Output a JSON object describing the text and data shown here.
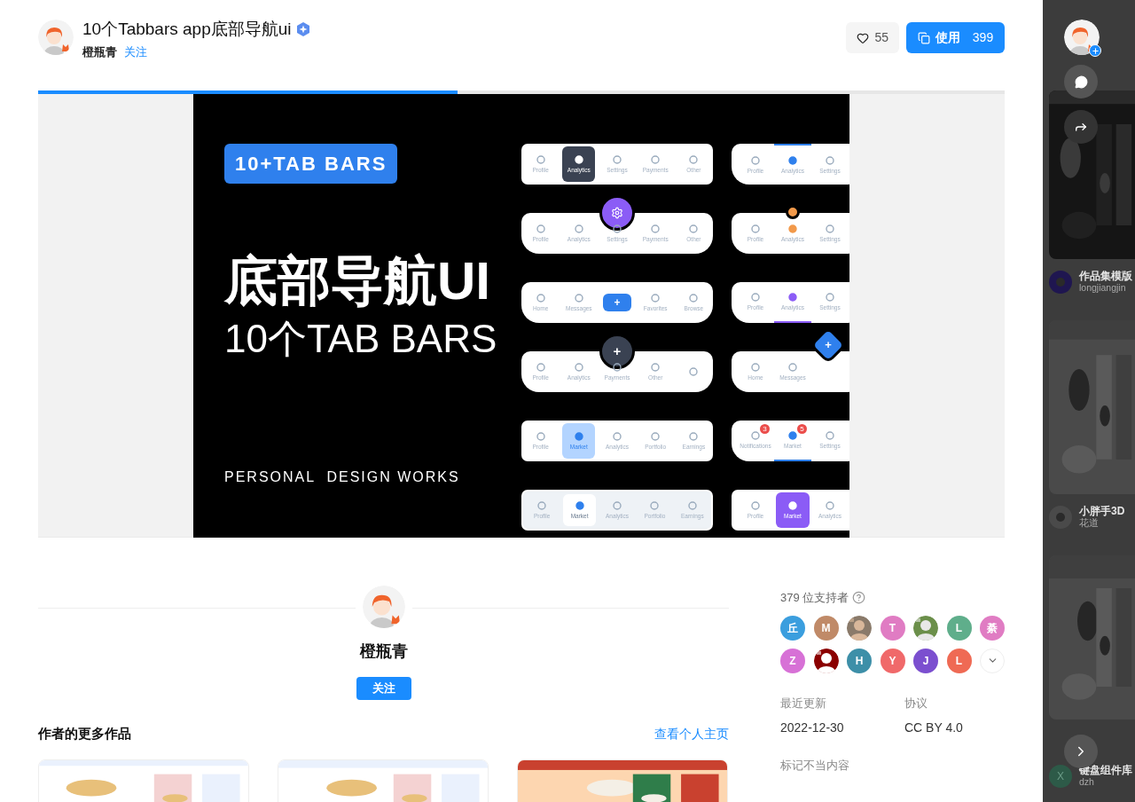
{
  "header": {
    "title": "10个Tabbars app底部导航ui",
    "author": "橙瓶青",
    "follow": "关注",
    "likes": "55",
    "use_label": "使用",
    "use_count": "399"
  },
  "preview": {
    "progress": {
      "level": 0.434
    },
    "badge": "10+TAB BARS",
    "headline": "底部导航UI",
    "subtitle": "10个TAB BARS",
    "footer": "PERSONAL  DESIGN WORKS",
    "tab_bar_columns": [
      {
        "bars": [
          {
            "kind": "pill",
            "color": "#3a4252",
            "items": [
              {
                "label": "Profile",
                "selected": false
              },
              {
                "label": "Analytics",
                "selected": true
              },
              {
                "label": "Settings",
                "selected": false
              },
              {
                "label": "Payments",
                "selected": false
              },
              {
                "label": "Other",
                "selected": false
              }
            ]
          },
          {
            "kind": "plain",
            "color": "#8b5cf6",
            "fab": {
              "kind": "circle"
            },
            "items": [
              {
                "label": "Profile",
                "selected": false
              },
              {
                "label": "Analytics",
                "selected": false
              },
              {
                "label": "Settings",
                "selected": false
              },
              {
                "label": "Payments",
                "selected": false
              },
              {
                "label": "Other",
                "selected": false
              }
            ]
          },
          {
            "kind": "plain",
            "color": "#2f80ed",
            "items": [
              {
                "label": "Home",
                "selected": false
              },
              {
                "label": "Messages",
                "selected": false
              },
              {
                "kind": "button",
                "label": "+"
              },
              {
                "label": "Favorites",
                "selected": false
              },
              {
                "label": "Browse",
                "selected": false
              }
            ]
          },
          {
            "kind": "plain",
            "color": "#3a4252",
            "fab": {
              "kind": "circle",
              "symbol": "+"
            },
            "items": [
              {
                "label": "Profile",
                "selected": false
              },
              {
                "label": "Analytics",
                "selected": false
              },
              {
                "label": "Payments",
                "selected": false
              },
              {
                "label": "Other",
                "selected": false
              },
              {
                "selected": false
              }
            ]
          },
          {
            "kind": "pill",
            "color": "#b3d4ff",
            "items": [
              {
                "label": "Profile",
                "selected": false
              },
              {
                "label": "Market",
                "selected": true
              },
              {
                "label": "Analytics",
                "selected": false
              },
              {
                "label": "Portfolio",
                "selected": false
              },
              {
                "label": "Earnings",
                "selected": false
              }
            ]
          },
          {
            "kind": "segmented",
            "color": "#2f80ed",
            "items": [
              {
                "label": "Profile",
                "selected": false
              },
              {
                "label": "Market",
                "selected": true
              },
              {
                "label": "Analytics",
                "selected": false
              },
              {
                "label": "Portfolio",
                "selected": false
              },
              {
                "label": "Earnings",
                "selected": false
              }
            ]
          }
        ]
      },
      {
        "bars": [
          {
            "kind": "underline-top",
            "color": "#2f80ed",
            "items": [
              {
                "label": "Profile",
                "selected": false
              },
              {
                "label": "Analytics",
                "selected": true
              },
              {
                "label": "Settings",
                "selected": false
              }
            ]
          },
          {
            "kind": "dot",
            "color": "#f2994a",
            "items": [
              {
                "label": "Profile",
                "selected": false
              },
              {
                "label": "Analytics",
                "selected": true
              },
              {
                "label": "Settings",
                "selected": false
              }
            ]
          },
          {
            "kind": "underline-bottom",
            "color": "#8b5cf6",
            "items": [
              {
                "label": "Profile",
                "selected": false
              },
              {
                "label": "Analytics",
                "selected": true
              },
              {
                "label": "Settings",
                "selected": false
              }
            ]
          },
          {
            "kind": "plain",
            "color": "#2f80ed",
            "fab": {
              "kind": "diamond",
              "symbol": "+"
            },
            "items": [
              {
                "label": "Home",
                "selected": false
              },
              {
                "label": "Messages",
                "selected": false
              }
            ]
          },
          {
            "kind": "underline-bottom",
            "color": "#2f80ed",
            "items": [
              {
                "label": "Notifications",
                "selected": false,
                "badge": "3"
              },
              {
                "label": "Market",
                "selected": true,
                "badge": "5"
              },
              {
                "label": "Settings",
                "selected": false
              }
            ]
          },
          {
            "kind": "pill",
            "color": "#8b5cf6",
            "items": [
              {
                "label": "Profile",
                "selected": false
              },
              {
                "label": "Market",
                "selected": true
              },
              {
                "label": "Analytics",
                "selected": false
              }
            ]
          }
        ]
      }
    ]
  },
  "author_card": {
    "name": "橙瓶青",
    "follow": "关注"
  },
  "more_works": {
    "title": "作者的更多作品",
    "link": "查看个人主页",
    "cards": [
      {
        "kind": "picture"
      },
      {
        "kind": "picture"
      },
      {
        "kind": "picture"
      }
    ]
  },
  "supporters": {
    "title": "379 位支持者",
    "people": [
      {
        "initial": "丘",
        "color": "#3b9ede"
      },
      {
        "initial": "M",
        "color": "#c08a68"
      },
      {
        "kind": "picture"
      },
      {
        "initial": "T",
        "color": "#e07cc3"
      },
      {
        "kind": "picture"
      },
      {
        "initial": "L",
        "color": "#5fae8b"
      },
      {
        "initial": "綦",
        "color": "#e07cc3"
      },
      {
        "initial": "Z",
        "color": "#d771d6"
      },
      {
        "kind": "picture"
      },
      {
        "initial": "H",
        "color": "#3d8fa8"
      },
      {
        "initial": "Y",
        "color": "#f0696a"
      },
      {
        "initial": "J",
        "color": "#7b4fcf"
      },
      {
        "initial": "L",
        "color": "#ef6a54"
      }
    ]
  },
  "meta": [
    {
      "label": "最近更新",
      "value": "2022-12-30"
    },
    {
      "label": "协议",
      "value": "CC BY 4.0"
    }
  ],
  "report": "标记不当内容",
  "side_feed": [
    {
      "title": "作品集模版",
      "author": "longjiangjin"
    },
    {
      "title": "小胖手3D",
      "author": "花道"
    },
    {
      "title": "键盘组件库",
      "author": "dzh",
      "initial": "X"
    }
  ]
}
